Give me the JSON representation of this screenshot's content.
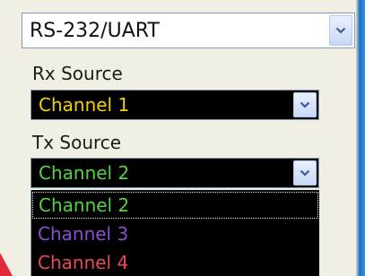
{
  "mode_select": {
    "value": "RS-232/UART"
  },
  "rx": {
    "label": "Rx Source",
    "value": "Channel 1",
    "color": "#f0d200"
  },
  "tx": {
    "label": "Tx Source",
    "value": "Channel 2",
    "color": "#55d443",
    "options": [
      {
        "label": "Channel 2",
        "color": "#55d443"
      },
      {
        "label": "Channel 3",
        "color": "#8a4fd0"
      },
      {
        "label": "Channel 4",
        "color": "#e84a5a"
      }
    ]
  },
  "icons": {
    "dropdown_arrow": "chevron-down-icon"
  }
}
